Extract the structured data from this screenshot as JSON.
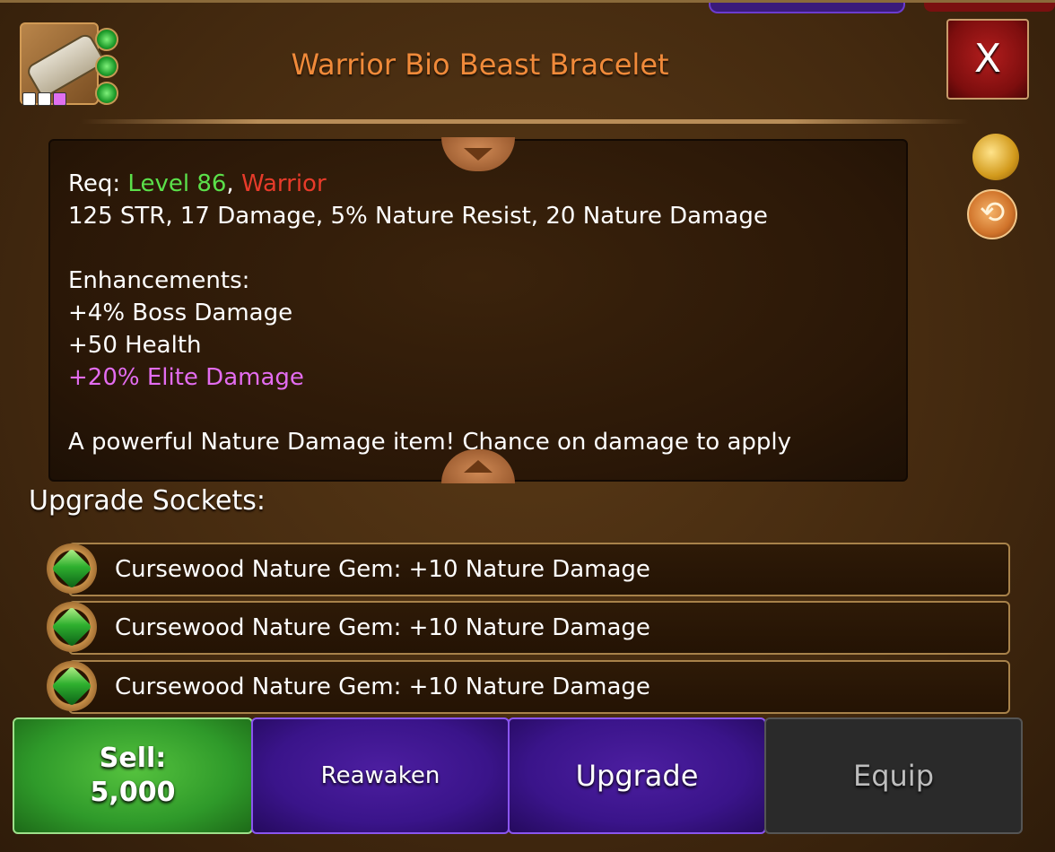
{
  "item": {
    "title": "Warrior Bio Beast Bracelet",
    "icon": "bracelet-icon",
    "rarity_pips": [
      "#ffffff",
      "#ffffff",
      "#e070f0"
    ],
    "gem_slots": 3
  },
  "close_label": "X",
  "description": {
    "req_label": "Req: ",
    "req_level": "Level 86",
    "req_sep": ", ",
    "req_class": "Warrior",
    "stats": "125 STR, 17 Damage, 5% Nature Resist, 20 Nature Damage",
    "enh_header": "Enhancements:",
    "enh_1": "+4% Boss Damage",
    "enh_2": "+50 Health",
    "enh_3": "+20% Elite Damage",
    "flavor": "A powerful Nature Damage item! Chance on damage to apply"
  },
  "colors": {
    "title": "#f08a3a",
    "level": "#5be04a",
    "class": "#e73b2a",
    "elite_enhancement": "#e36cf0"
  },
  "side_icons": [
    "coin-bag-icon",
    "swap-icon"
  ],
  "sockets": {
    "label": "Upgrade Sockets:",
    "items": [
      {
        "text": "Cursewood Nature Gem: +10 Nature Damage",
        "icon": "green-gem-icon"
      },
      {
        "text": "Cursewood Nature Gem: +10 Nature Damage",
        "icon": "green-gem-icon"
      },
      {
        "text": "Cursewood Nature Gem: +10 Nature Damage",
        "icon": "green-gem-icon"
      }
    ]
  },
  "actions": {
    "sell_label": "Sell:",
    "sell_price": "5,000",
    "reawaken": "Reawaken",
    "upgrade": "Upgrade",
    "equip": "Equip"
  }
}
